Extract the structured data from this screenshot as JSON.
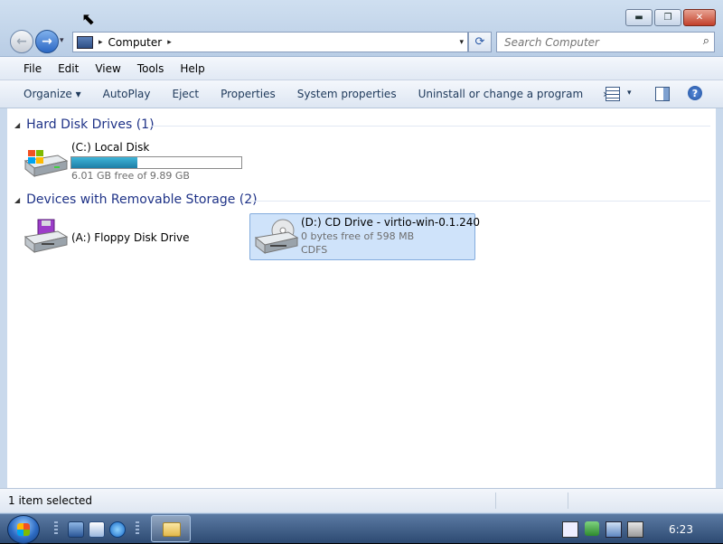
{
  "window": {
    "caption_buttons": {
      "minimize": "▬",
      "maximize": "❐",
      "close": "✕"
    }
  },
  "nav": {
    "back_glyph": "←",
    "forward_glyph": "→",
    "recent_glyph": "▾",
    "address_separator": "▸",
    "address_location": "Computer",
    "address_trailing_separator": "▸",
    "address_dropdown": "▾",
    "refresh_glyph": "⟳",
    "search_placeholder": "Search Computer",
    "search_glyph": "⌕"
  },
  "menubar": {
    "items": [
      "File",
      "Edit",
      "View",
      "Tools",
      "Help"
    ]
  },
  "commandbar": {
    "organize": "Organize ▾",
    "autoplay": "AutoPlay",
    "eject": "Eject",
    "properties": "Properties",
    "system_properties": "System properties",
    "uninstall": "Uninstall or change a program",
    "more": "»",
    "view_dropdown": "▾",
    "help": "?"
  },
  "groups": {
    "hard_disks": {
      "title": "Hard Disk Drives (1)",
      "toggle": "◢"
    },
    "removable": {
      "title": "Devices with Removable Storage (2)",
      "toggle": "◢"
    }
  },
  "drives": {
    "c": {
      "name": "(C:) Local Disk",
      "info": "6.01 GB free of 9.89 GB",
      "used_fraction": 0.39
    },
    "a": {
      "name": "(A:) Floppy Disk Drive"
    },
    "d": {
      "name": "(D:) CD Drive - virtio-win-0.1.240",
      "info": "0 bytes free of 598 MB",
      "fs": "CDFS",
      "selected": true
    }
  },
  "statusbar": {
    "text": "1 item selected"
  },
  "taskbar": {
    "clock": "6:23"
  },
  "colors": {
    "group_header": "#1e3287",
    "selection": "#cfe3fa",
    "usage_fill": "#1d7ea6"
  }
}
